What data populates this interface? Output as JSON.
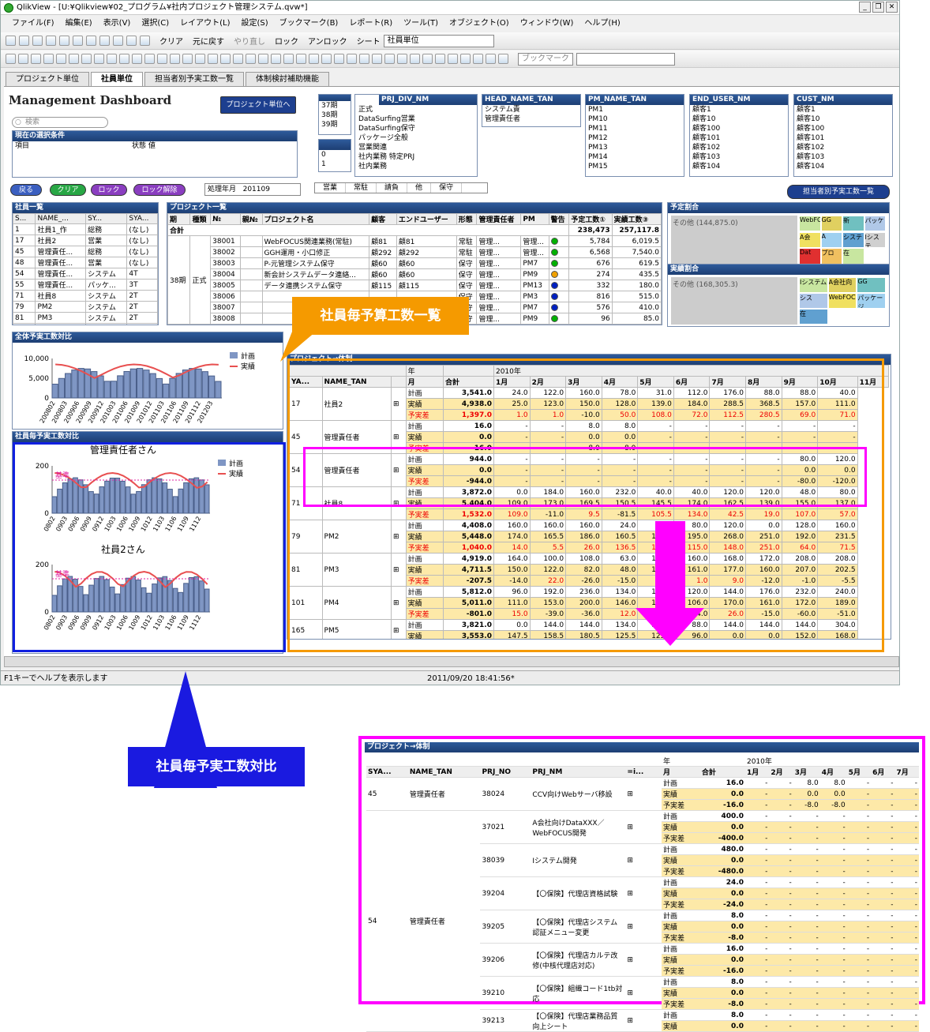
{
  "window": {
    "title": "QlikView - [U:¥Qlikview¥02_プログラム¥社内プロジェクト管理システム.qvw*]"
  },
  "menu": [
    "ファイル(F)",
    "編集(E)",
    "表示(V)",
    "選択(C)",
    "レイアウト(L)",
    "設定(S)",
    "ブックマーク(B)",
    "レポート(R)",
    "ツール(T)",
    "オブジェクト(O)",
    "ウィンドウ(W)",
    "ヘルプ(H)"
  ],
  "toolbar": {
    "clear": "クリア",
    "back": "元に戻す",
    "redo": "やり直し",
    "lock": "ロック",
    "unlock": "アンロック",
    "sheet_label": "シート",
    "sheet_value": "社員単位",
    "bookmark_placeholder": "ブックマーク"
  },
  "tabs": [
    "プロジェクト単位",
    "社員単位",
    "担当者別予実工数一覧",
    "体制検討補助機能"
  ],
  "dashboard": {
    "title": "Management Dashboard",
    "to_project_button": "プロジェクト単位へ",
    "search_placeholder": "検索",
    "staff_list_button": "担当者別予実工数一覧"
  },
  "current_selection": {
    "title": "現在の選択条件",
    "col_item": "項目",
    "col_status": "状態",
    "col_value": "値"
  },
  "action_buttons": [
    "戻る",
    "クリア",
    "ロック",
    "ロック解除"
  ],
  "processing": {
    "label": "処理年月",
    "value": "201109"
  },
  "period_list": {
    "items": [
      "37期",
      "38期",
      "39期"
    ]
  },
  "small_list": {
    "values": [
      "0",
      "1"
    ]
  },
  "prj_div": {
    "title": "PRJ_DIV_NM",
    "items": [
      "正式",
      "DataSurfing営業",
      "DataSurfing保守",
      "パッケージ全般",
      "営業関連",
      "社内業務 特定PRJ",
      "社内業務"
    ],
    "colors": [
      "#808080",
      "#e00000",
      "#0020c0",
      "#f0a000",
      "#00b000",
      "#d0d000",
      "#00b000"
    ]
  },
  "head_name": {
    "title": "HEAD_NAME_TAN",
    "items": [
      "システム責",
      "管理責任者"
    ]
  },
  "pm_name": {
    "title": "PM_NAME_TAN",
    "items": [
      "PM1",
      "PM10",
      "PM11",
      "PM12",
      "PM13",
      "PM14",
      "PM15"
    ]
  },
  "end_user": {
    "title": "END_USER_NM",
    "items": [
      "顧客1",
      "顧客10",
      "顧客100",
      "顧客101",
      "顧客102",
      "顧客103",
      "顧客104"
    ]
  },
  "cust": {
    "title": "CUST_NM",
    "items": [
      "顧客1",
      "顧客10",
      "顧客100",
      "顧客101",
      "顧客102",
      "顧客103",
      "顧客104"
    ]
  },
  "contract_types": [
    "営業",
    "常駐",
    "請負",
    "他",
    "保守"
  ],
  "staff_list": {
    "title": "社員一覧",
    "headers": [
      "S...",
      "NAME_...",
      "SY...",
      "SYA..."
    ],
    "rows": [
      [
        "1",
        "社員1_作",
        "総務",
        "(なし)"
      ],
      [
        "17",
        "社員2",
        "営業",
        "(なし)"
      ],
      [
        "45",
        "管理責任...",
        "総務",
        "(なし)"
      ],
      [
        "48",
        "管理責任...",
        "営業",
        "(なし)"
      ],
      [
        "54",
        "管理責任...",
        "システム",
        "4T"
      ],
      [
        "55",
        "管理責任...",
        "パッケ...",
        "3T"
      ],
      [
        "71",
        "社員8",
        "システム",
        "2T"
      ],
      [
        "79",
        "PM2",
        "システム",
        "2T"
      ],
      [
        "81",
        "PM3",
        "システム",
        "2T"
      ],
      [
        "101",
        "PM4",
        "システム",
        "1T"
      ]
    ]
  },
  "project_list": {
    "title": "プロジェクト一覧",
    "headers": [
      "期",
      "種類",
      "№",
      "親№",
      "プロジェクト名",
      "顧客",
      "エンドユーザー",
      "形態",
      "管理責任者",
      "PM",
      "警告",
      "予定工数①",
      "実績工数③"
    ],
    "total_label": "合計",
    "total_plan": "238,473",
    "total_actual": "257,117.8",
    "period": "38期",
    "kind": "正式",
    "rows": [
      [
        "38001",
        "",
        "WebFOCUS関連業務(常駐)",
        "顧81",
        "顧81",
        "常駐",
        "管理...",
        "管理...",
        "#00b000",
        "5,784",
        "6,019.5"
      ],
      [
        "38002",
        "",
        "GGH運用・小口修正",
        "顧292",
        "顧292",
        "常駐",
        "管理...",
        "管理...",
        "#00b000",
        "6,568",
        "7,540.0"
      ],
      [
        "38003",
        "",
        "P-元管理システム保守",
        "顧60",
        "顧60",
        "保守",
        "管理...",
        "PM7",
        "#00b000",
        "676",
        "619.5"
      ],
      [
        "38004",
        "",
        "新会計システムデータ連絡...",
        "顧60",
        "顧60",
        "保守",
        "管理...",
        "PM9",
        "#f0a000",
        "274",
        "435.5"
      ],
      [
        "38005",
        "",
        "データ連携システム保守",
        "顧115",
        "顧115",
        "保守",
        "管理...",
        "PM13",
        "#0020c0",
        "332",
        "180.0"
      ],
      [
        "38006",
        "",
        "",
        "",
        "",
        "保守",
        "管理...",
        "PM3",
        "#0020c0",
        "816",
        "515.0"
      ],
      [
        "38007",
        "",
        "",
        "",
        "",
        "保守",
        "管理...",
        "PM7",
        "#0020c0",
        "576",
        "410.0"
      ],
      [
        "38008",
        "",
        "",
        "",
        "",
        "保守",
        "管理...",
        "PM9",
        "#00b000",
        "96",
        "85.0"
      ]
    ]
  },
  "plan_ratio": {
    "title": "予定割合",
    "other": "その他 (144,875.0)",
    "cells": [
      "WebFOCU",
      "GG",
      "新",
      "パッケ",
      "A会",
      "A",
      "システ",
      "Iシステ",
      "Dat",
      "プロ",
      "在"
    ]
  },
  "actual_ratio": {
    "title": "実績割合",
    "other": "その他 (168,305.3)",
    "cells": [
      "Iシステム",
      "A会社向",
      "GG",
      "シス",
      "WebFOC",
      "パッケージ",
      "在"
    ]
  },
  "overall_chart": {
    "title": "全体予実工数対比",
    "legend_plan": "計画",
    "legend_actual": "実績",
    "yticks": [
      "10,000",
      "5,000",
      "0"
    ],
    "xticks": [
      "200802",
      "200803",
      "200906",
      "200909",
      "200912",
      "201003",
      "201006",
      "201009",
      "201012",
      "201103",
      "201106",
      "201109",
      "201112",
      "201203"
    ]
  },
  "per_staff": {
    "title": "社員毎予実工数対比",
    "legend_plan": "計画",
    "legend_actual": "実績",
    "baseline": "基準",
    "charts": [
      {
        "name": "管理責任者さん"
      },
      {
        "name": "社員2さん"
      }
    ],
    "yticks": [
      "200",
      "0"
    ],
    "xticks": [
      "0802",
      "0903",
      "0906",
      "0909",
      "0912",
      "1003",
      "1006",
      "1009",
      "1012",
      "1103",
      "1106",
      "1109",
      "1112"
    ]
  },
  "annotation_budget": "社員毎予算工数一覧",
  "annotation_compare": "社員毎予実工数対比",
  "pivot": {
    "title": "プロジェクト→体制",
    "year_label": "年",
    "month_label": "月",
    "total_label": "合計",
    "year_value": "2010年",
    "col_ya": "YA...",
    "col_name": "NAME_TAN",
    "months": [
      "1月",
      "2月",
      "3月",
      "4月",
      "5月",
      "6月",
      "7月",
      "8月",
      "9月",
      "10月",
      "11月"
    ],
    "groups": [
      {
        "id": "17",
        "name": "社員2",
        "rows": [
          [
            "計画",
            "3,541.0",
            "24.0",
            "122.0",
            "160.0",
            "78.0",
            "31.0",
            "112.0",
            "176.0",
            "88.0",
            "88.0",
            "40.0"
          ],
          [
            "実績",
            "4,938.0",
            "25.0",
            "123.0",
            "150.0",
            "128.0",
            "139.0",
            "184.0",
            "288.5",
            "368.5",
            "157.0",
            "111.0"
          ],
          [
            "予実差",
            "1,397.0",
            "1.0",
            "1.0",
            "-10.0",
            "50.0",
            "108.0",
            "72.0",
            "112.5",
            "280.5",
            "69.0",
            "71.0"
          ]
        ]
      },
      {
        "id": "45",
        "name": "管理責任者",
        "rows": [
          [
            "計画",
            "16.0",
            "-",
            "-",
            "8.0",
            "8.0",
            "-",
            "-",
            "-",
            "-",
            "-",
            "-"
          ],
          [
            "実績",
            "0.0",
            "-",
            "-",
            "0.0",
            "0.0",
            "-",
            "-",
            "-",
            "-",
            "-",
            "-"
          ],
          [
            "予実差",
            "-16.0",
            "-",
            "-",
            "-8.0",
            "-8.0",
            "-",
            "-",
            "-",
            "-",
            "-",
            "-"
          ]
        ]
      },
      {
        "id": "54",
        "name": "管理責任者",
        "rows": [
          [
            "計画",
            "944.0",
            "-",
            "-",
            "-",
            "-",
            "-",
            "-",
            "-",
            "-",
            "80.0",
            "120.0"
          ],
          [
            "実績",
            "0.0",
            "-",
            "-",
            "-",
            "-",
            "-",
            "-",
            "-",
            "-",
            "0.0",
            "0.0"
          ],
          [
            "予実差",
            "-944.0",
            "-",
            "-",
            "-",
            "-",
            "-",
            "-",
            "-",
            "-",
            "-80.0",
            "-120.0"
          ]
        ]
      },
      {
        "id": "71",
        "name": "社員8",
        "rows": [
          [
            "計画",
            "3,872.0",
            "0.0",
            "184.0",
            "160.0",
            "232.0",
            "40.0",
            "40.0",
            "120.0",
            "120.0",
            "48.0",
            "80.0"
          ],
          [
            "実績",
            "5,404.0",
            "109.0",
            "173.0",
            "169.5",
            "150.5",
            "145.5",
            "174.0",
            "162.5",
            "139.0",
            "155.0",
            "137.0"
          ],
          [
            "予実差",
            "1,532.0",
            "109.0",
            "-11.0",
            "9.5",
            "-81.5",
            "105.5",
            "134.0",
            "42.5",
            "19.0",
            "107.0",
            "57.0"
          ]
        ]
      },
      {
        "id": "79",
        "name": "PM2",
        "rows": [
          [
            "計画",
            "4,408.0",
            "160.0",
            "160.0",
            "160.0",
            "24.0",
            "0.0",
            "80.0",
            "120.0",
            "0.0",
            "128.0",
            "160.0"
          ],
          [
            "実績",
            "5,448.0",
            "174.0",
            "165.5",
            "186.0",
            "160.5",
            "128.0",
            "195.0",
            "268.0",
            "251.0",
            "192.0",
            "231.5"
          ],
          [
            "予実差",
            "1,040.0",
            "14.0",
            "5.5",
            "26.0",
            "136.5",
            "128.0",
            "115.0",
            "148.0",
            "251.0",
            "64.0",
            "71.5"
          ]
        ]
      },
      {
        "id": "81",
        "name": "PM3",
        "rows": [
          [
            "計画",
            "4,919.0",
            "164.0",
            "100.0",
            "108.0",
            "63.0",
            "136.0",
            "160.0",
            "168.0",
            "172.0",
            "208.0",
            "208.0"
          ],
          [
            "実績",
            "4,711.5",
            "150.0",
            "122.0",
            "82.0",
            "48.0",
            "132.0",
            "161.0",
            "177.0",
            "160.0",
            "207.0",
            "202.5"
          ],
          [
            "予実差",
            "-207.5",
            "-14.0",
            "22.0",
            "-26.0",
            "-15.0",
            "-4.0",
            "1.0",
            "9.0",
            "-12.0",
            "-1.0",
            "-5.5"
          ]
        ]
      },
      {
        "id": "101",
        "name": "PM4",
        "rows": [
          [
            "計画",
            "5,812.0",
            "96.0",
            "192.0",
            "236.0",
            "134.0",
            "168.0",
            "120.0",
            "144.0",
            "176.0",
            "232.0",
            "240.0"
          ],
          [
            "実績",
            "5,011.0",
            "111.0",
            "153.0",
            "200.0",
            "146.0",
            "137.0",
            "106.0",
            "170.0",
            "161.0",
            "172.0",
            "189.0"
          ],
          [
            "予実差",
            "-801.0",
            "15.0",
            "-39.0",
            "-36.0",
            "12.0",
            "-31.0",
            "-14.0",
            "26.0",
            "-15.0",
            "-60.0",
            "-51.0"
          ]
        ]
      },
      {
        "id": "165",
        "name": "PM5",
        "rows": [
          [
            "計画",
            "3,821.0",
            "0.0",
            "144.0",
            "144.0",
            "134.0",
            "136.0",
            "88.0",
            "144.0",
            "144.0",
            "144.0",
            "304.0"
          ],
          [
            "実績",
            "3,553.0",
            "147.5",
            "158.5",
            "180.5",
            "125.5",
            "125.0",
            "96.0",
            "0.0",
            "0.0",
            "152.0",
            "168.0"
          ]
        ]
      }
    ]
  },
  "zoom": {
    "title": "プロジェクト→体制",
    "col_sya": "SYA...",
    "col_name": "NAME_TAN",
    "col_prj_no": "PRJ_NO",
    "col_prj_nm": "PRJ_NM",
    "col_i": "=i...",
    "year_label": "年",
    "month_label": "月",
    "total_label": "合計",
    "year_value": "2010年",
    "months": [
      "1月",
      "2月",
      "3月",
      "4月",
      "5月",
      "6月",
      "7月"
    ],
    "group1": {
      "id": "45",
      "name": "管理責任者"
    },
    "group2": {
      "id": "54",
      "name": "管理責任者"
    },
    "projects": [
      {
        "no": "38024",
        "name": "CCV向けWebサーバ移設",
        "group": 1,
        "rows": [
          [
            "計画",
            "16.0",
            "-",
            "-",
            "8.0",
            "8.0",
            "-",
            "-",
            "-"
          ],
          [
            "実績",
            "0.0",
            "-",
            "-",
            "0.0",
            "0.0",
            "-",
            "-",
            "-"
          ],
          [
            "予実差",
            "-16.0",
            "-",
            "-",
            "-8.0",
            "-8.0",
            "-",
            "-",
            "-"
          ]
        ]
      },
      {
        "no": "37021",
        "name": "A会社向けDataXXX／WebFOCUS開発",
        "group": 2,
        "rows": [
          [
            "計画",
            "400.0",
            "-",
            "-",
            "-",
            "-",
            "-",
            "-",
            "-"
          ],
          [
            "実績",
            "0.0",
            "-",
            "-",
            "-",
            "-",
            "-",
            "-",
            "-"
          ],
          [
            "予実差",
            "-400.0",
            "-",
            "-",
            "-",
            "-",
            "-",
            "-",
            "-"
          ]
        ]
      },
      {
        "no": "38039",
        "name": "Iシステム開発",
        "group": 2,
        "rows": [
          [
            "計画",
            "480.0",
            "-",
            "-",
            "-",
            "-",
            "-",
            "-",
            "-"
          ],
          [
            "実績",
            "0.0",
            "-",
            "-",
            "-",
            "-",
            "-",
            "-",
            "-"
          ],
          [
            "予実差",
            "-480.0",
            "-",
            "-",
            "-",
            "-",
            "-",
            "-",
            "-"
          ]
        ]
      },
      {
        "no": "39204",
        "name": "【〇保険】代理店資格試験",
        "group": 2,
        "rows": [
          [
            "計画",
            "24.0",
            "-",
            "-",
            "-",
            "-",
            "-",
            "-",
            "-"
          ],
          [
            "実績",
            "0.0",
            "-",
            "-",
            "-",
            "-",
            "-",
            "-",
            "-"
          ],
          [
            "予実差",
            "-24.0",
            "-",
            "-",
            "-",
            "-",
            "-",
            "-",
            "-"
          ]
        ]
      },
      {
        "no": "39205",
        "name": "【〇保険】代理店システム認証メニュー変更",
        "group": 2,
        "rows": [
          [
            "計画",
            "8.0",
            "-",
            "-",
            "-",
            "-",
            "-",
            "-",
            "-"
          ],
          [
            "実績",
            "0.0",
            "-",
            "-",
            "-",
            "-",
            "-",
            "-",
            "-"
          ],
          [
            "予実差",
            "-8.0",
            "-",
            "-",
            "-",
            "-",
            "-",
            "-",
            "-"
          ]
        ]
      },
      {
        "no": "39206",
        "name": "【〇保険】代理店カルテ改修(中核代理店対応)",
        "group": 2,
        "rows": [
          [
            "計画",
            "16.0",
            "-",
            "-",
            "-",
            "-",
            "-",
            "-",
            "-"
          ],
          [
            "実績",
            "0.0",
            "-",
            "-",
            "-",
            "-",
            "-",
            "-",
            "-"
          ],
          [
            "予実差",
            "-16.0",
            "-",
            "-",
            "-",
            "-",
            "-",
            "-",
            "-"
          ]
        ]
      },
      {
        "no": "39210",
        "name": "【〇保険】組織コード1tb対応",
        "group": 2,
        "rows": [
          [
            "計画",
            "8.0",
            "-",
            "-",
            "-",
            "-",
            "-",
            "-",
            "-"
          ],
          [
            "実績",
            "0.0",
            "-",
            "-",
            "-",
            "-",
            "-",
            "-",
            "-"
          ],
          [
            "予実差",
            "-8.0",
            "-",
            "-",
            "-",
            "-",
            "-",
            "-",
            "-"
          ]
        ]
      },
      {
        "no": "39213",
        "name": "【〇保険】代理店業務品質向上シート",
        "group": 2,
        "rows": [
          [
            "計画",
            "8.0",
            "-",
            "-",
            "-",
            "-",
            "-",
            "-",
            "-"
          ],
          [
            "実績",
            "0.0",
            "-",
            "-",
            "-",
            "-",
            "-",
            "-",
            "-"
          ]
        ]
      }
    ]
  },
  "status": {
    "help": "F1キーでヘルプを表示します",
    "datetime": "2011/09/20 18:41:56*"
  }
}
